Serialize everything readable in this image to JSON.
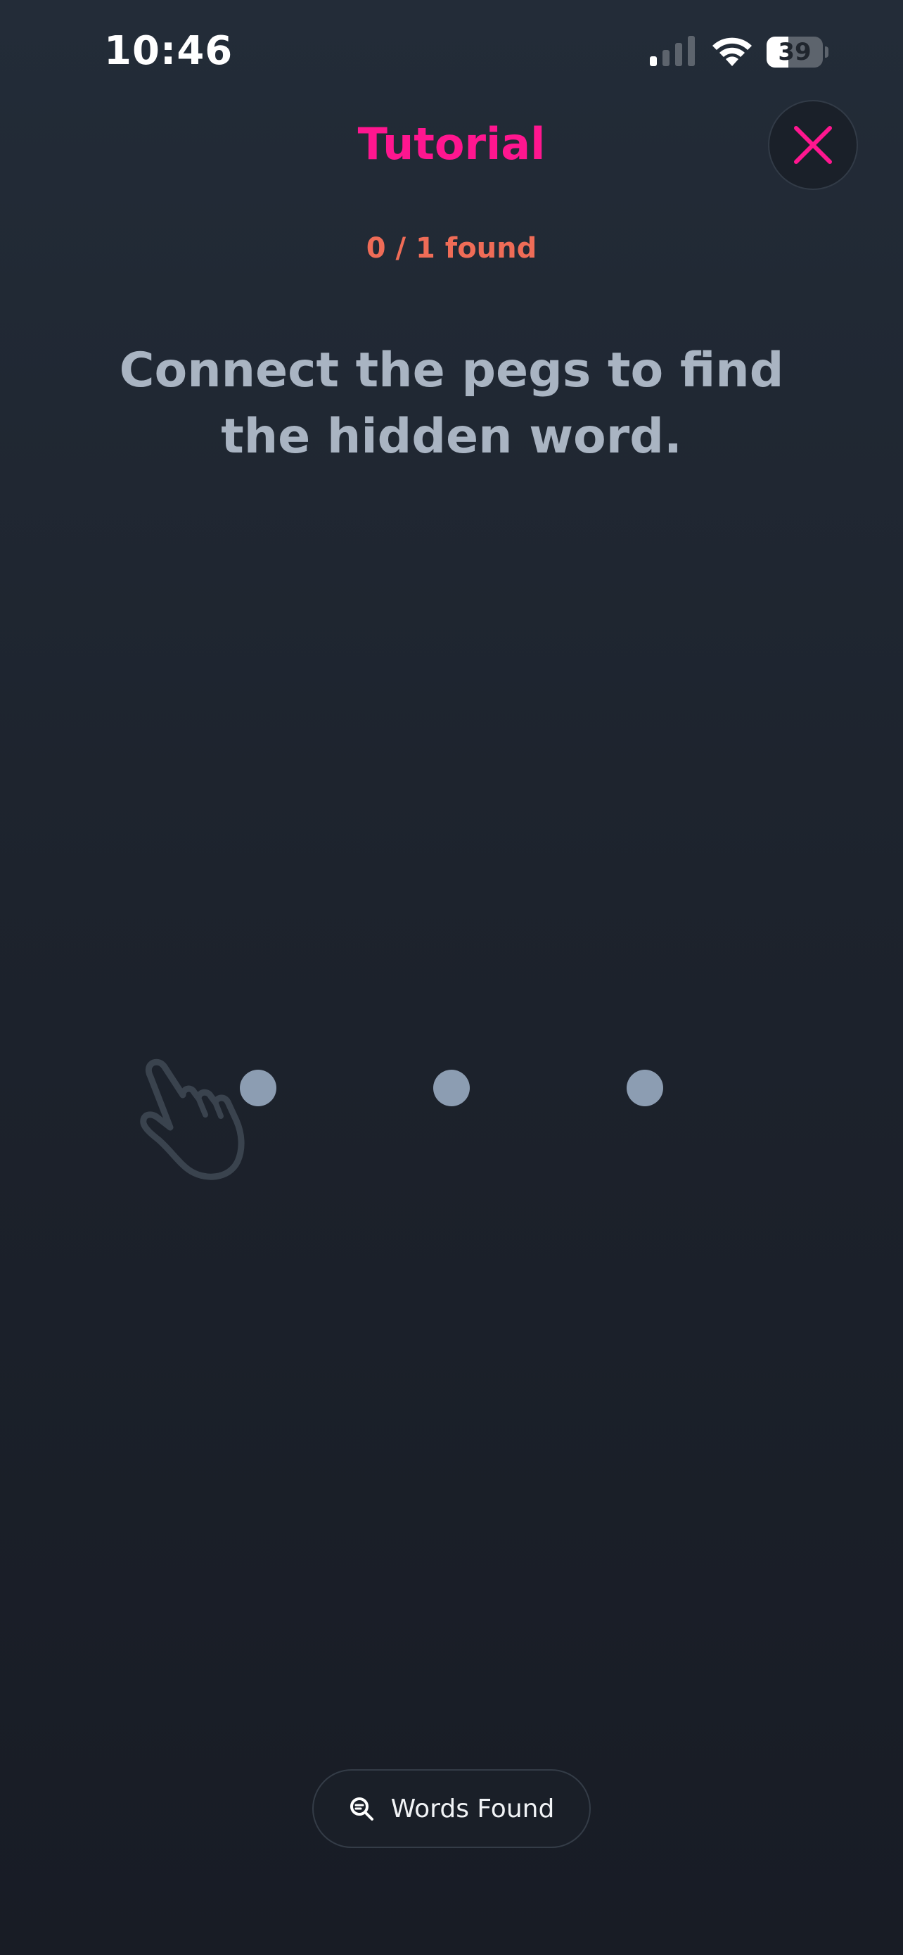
{
  "status_bar": {
    "time": "10:46",
    "battery_level": "39",
    "battery_fraction": 0.39,
    "signal_icon": "cellular-signal-icon",
    "wifi_icon": "wifi-icon"
  },
  "header": {
    "title": "Tutorial",
    "close_icon": "close-icon"
  },
  "progress": {
    "text": "0 / 1 found",
    "found": 0,
    "total": 1
  },
  "instruction": "Connect the pegs to find the hidden word.",
  "board": {
    "peg_count": 3,
    "hint_icon": "pointing-hand-icon"
  },
  "footer": {
    "words_found_label": "Words Found",
    "words_found_icon": "search-icon"
  },
  "colors": {
    "accent": "#ff168f",
    "progress": "#ef6c57",
    "instruction_text": "#a9b4c2",
    "peg": "#8c9db2",
    "background_top": "#232c38",
    "background_bottom": "#181c25"
  }
}
